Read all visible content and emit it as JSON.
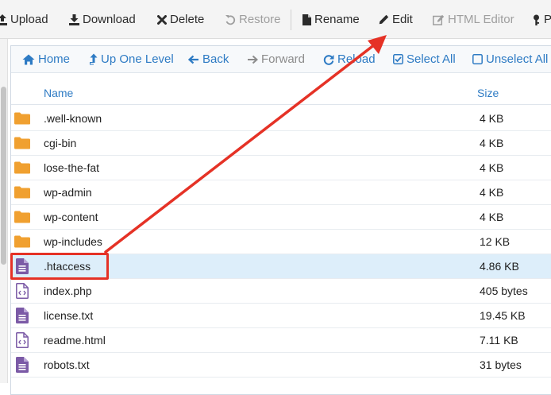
{
  "toolbar": {
    "upload": "Upload",
    "download": "Download",
    "delete": "Delete",
    "restore": "Restore",
    "rename": "Rename",
    "edit": "Edit",
    "html_editor": "HTML Editor",
    "partial": "P"
  },
  "nav": {
    "home": "Home",
    "up_one_level": "Up One Level",
    "back": "Back",
    "forward": "Forward",
    "reload": "Reload",
    "select_all": "Select All",
    "unselect_all": "Unselect All"
  },
  "table": {
    "col_name": "Name",
    "col_size": "Size",
    "rows": [
      {
        "name": ".well-known",
        "size": "4 KB",
        "type": "folder"
      },
      {
        "name": "cgi-bin",
        "size": "4 KB",
        "type": "folder"
      },
      {
        "name": "lose-the-fat",
        "size": "4 KB",
        "type": "folder"
      },
      {
        "name": "wp-admin",
        "size": "4 KB",
        "type": "folder"
      },
      {
        "name": "wp-content",
        "size": "4 KB",
        "type": "folder"
      },
      {
        "name": "wp-includes",
        "size": "12 KB",
        "type": "folder"
      },
      {
        "name": ".htaccess",
        "size": "4.86 KB",
        "type": "text-file",
        "selected": true
      },
      {
        "name": "index.php",
        "size": "405 bytes",
        "type": "code-file"
      },
      {
        "name": "license.txt",
        "size": "19.45 KB",
        "type": "text-file"
      },
      {
        "name": "readme.html",
        "size": "7.11 KB",
        "type": "code-file"
      },
      {
        "name": "robots.txt",
        "size": "31 bytes",
        "type": "text-file"
      }
    ]
  },
  "colors": {
    "link_blue": "#2e7bc4",
    "folder_orange": "#f0a030",
    "file_purple": "#7b5aa6",
    "annotation_red": "#e53226",
    "selected_row": "#ddeefa"
  }
}
